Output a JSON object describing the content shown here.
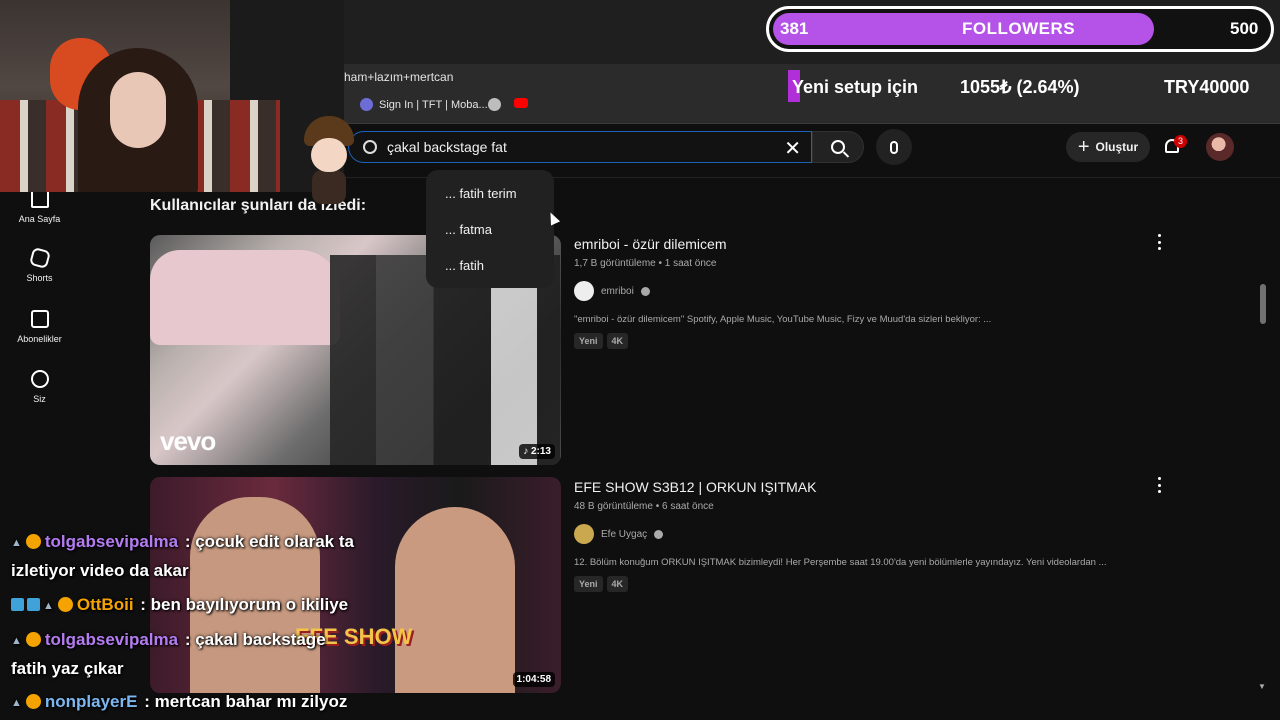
{
  "browser": {
    "address_text": "ham+lazım+mertcan",
    "bookmarks": [
      {
        "label": "Sign In | TFT | Moba...",
        "icon": "shield-icon"
      },
      {
        "label": "",
        "icon": "globe-icon"
      },
      {
        "label": "",
        "icon": "youtube-icon"
      }
    ],
    "window_controls": [
      "—",
      "❐",
      "✕"
    ]
  },
  "search": {
    "value": "çakal backstage fat",
    "clear_glyph": "✕"
  },
  "suggestions": [
    "... fatih terim",
    "... fatma",
    "... fatih"
  ],
  "header": {
    "create_label": "Oluştur",
    "create_glyph": "+",
    "notification_count": "3"
  },
  "guide": [
    {
      "label": "Ana Sayfa",
      "icon": "home-icon"
    },
    {
      "label": "Shorts",
      "icon": "shorts-icon"
    },
    {
      "label": "Abonelikler",
      "icon": "subscriptions-icon"
    },
    {
      "label": "Siz",
      "icon": "user-icon"
    }
  ],
  "section_title": "Kullanıcılar şunları da izledi:",
  "videos": [
    {
      "title": "emriboi - özür dilemicem",
      "meta": "1,7 B görüntüleme • 1 saat önce",
      "channel": "emriboi",
      "description": "\"emriboi - özür dilemicem\" Spotify, Apple Music, YouTube Music, Fizy ve Muud'da sizleri bekliyor: ...",
      "badges": [
        "Yeni",
        "4K"
      ],
      "duration": "♪ 2:13",
      "thumb_logo": "vevo"
    },
    {
      "title": "EFE SHOW S3B12 | ORKUN IŞITMAK",
      "meta": "48 B görüntüleme • 6 saat önce",
      "channel": "Efe Uygaç",
      "description": "12. Bölüm konuğum ORKUN IŞITMAK bizimleydi! Her Perşembe saat 19.00'da yeni bölümlerle yayındayız. Yeni videolardan ...",
      "badges": [
        "Yeni",
        "4K"
      ],
      "duration": "1:04:58",
      "thumb_logo": "EFE SHOW"
    }
  ],
  "follower_goal": {
    "current": "381",
    "label": "FOLLOWERS",
    "target": "500",
    "progress": 0.762,
    "fill_color": "#b553e8"
  },
  "donation_goal": {
    "name": "Yeni setup için",
    "amount": "1055₺ (2.64%)",
    "target": "TRY40000",
    "progress": 0.0264,
    "bar_color": "#b02fd8"
  },
  "chat": [
    {
      "user": "tolgabsevipalma",
      "user_color": "#b57cf2",
      "message": ": çocuk edit olarak ta",
      "badges": [
        "wave",
        "bits"
      ]
    },
    {
      "user": "",
      "user_color": "#ffffff",
      "message": "izletiyor video da akar",
      "badges": []
    },
    {
      "user": "OttBoii",
      "user_color": "#f5a300",
      "message": ": ben bayılıyorum o ikiliye",
      "badges": [
        "sub",
        "sub",
        "wave",
        "bits"
      ]
    },
    {
      "user": "tolgabsevipalma",
      "user_color": "#b57cf2",
      "message": ": çakal backstage",
      "badges": [
        "wave",
        "bits"
      ]
    },
    {
      "user": "",
      "user_color": "#ffffff",
      "message": "fatih yaz çıkar",
      "badges": []
    },
    {
      "user": "nonplayerE",
      "user_color": "#7cb7f2",
      "message": ": mertcan bahar mı zilyoz",
      "badges": [
        "wave",
        "bits"
      ]
    }
  ]
}
